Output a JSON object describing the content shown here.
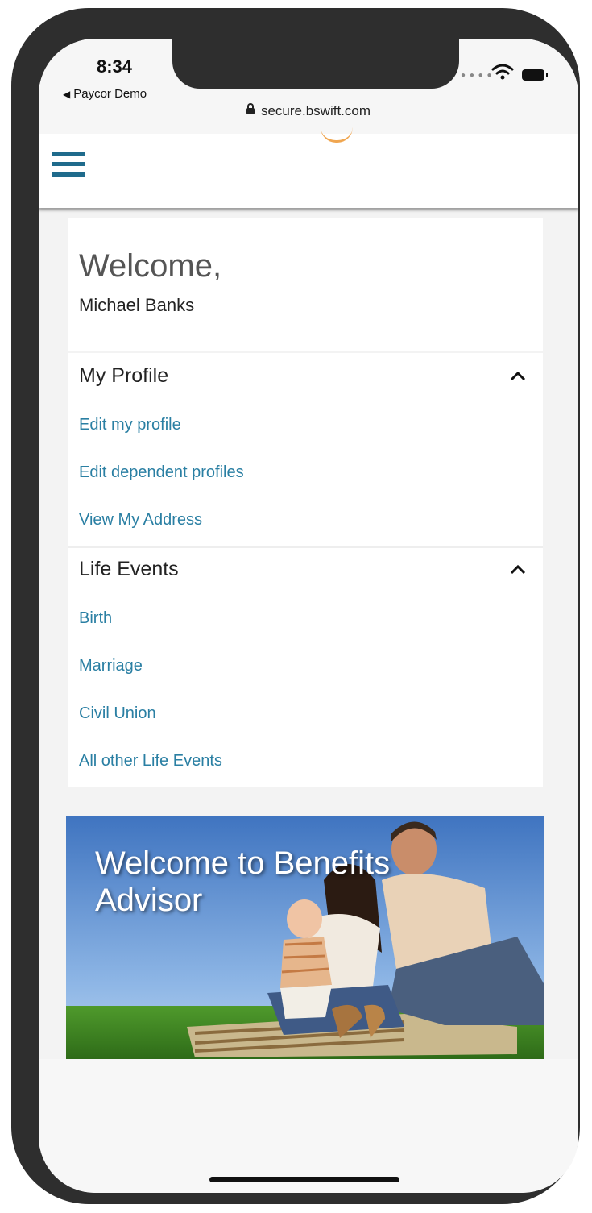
{
  "status_bar": {
    "time": "8:34",
    "back_app": "Paycor Demo",
    "url": "secure.bswift.com"
  },
  "header": {
    "menu_icon": "hamburger-icon"
  },
  "welcome": {
    "greeting": "Welcome,",
    "name": "Michael Banks"
  },
  "sections": {
    "profile": {
      "title": "My Profile",
      "links": [
        "Edit my profile",
        "Edit dependent profiles",
        "View My Address"
      ]
    },
    "life_events": {
      "title": "Life Events",
      "links": [
        "Birth",
        "Marriage",
        "Civil Union",
        "All other Life Events"
      ]
    }
  },
  "banner": {
    "line1": "Welcome to Benefits",
    "line2": "Advisor"
  },
  "colors": {
    "link": "#2a7fa3",
    "brand_blue": "#1f6b8c",
    "frame": "#2e2e2e"
  }
}
